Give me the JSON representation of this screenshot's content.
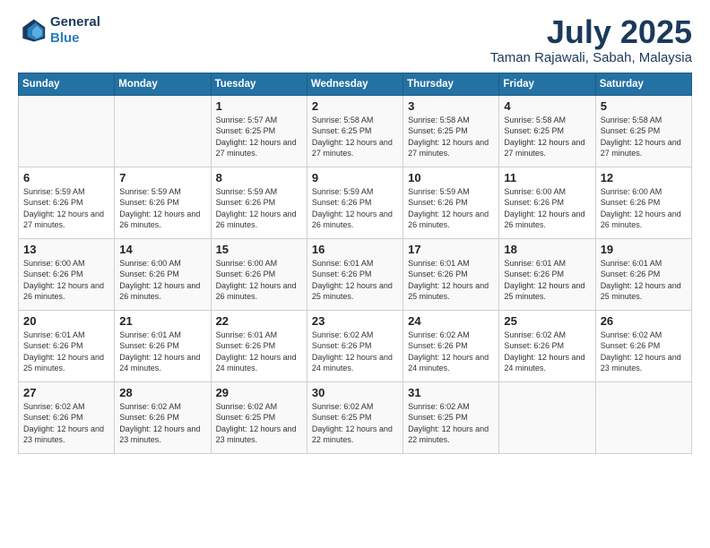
{
  "logo": {
    "line1": "General",
    "line2": "Blue"
  },
  "title": "July 2025",
  "subtitle": "Taman Rajawali, Sabah, Malaysia",
  "days_of_week": [
    "Sunday",
    "Monday",
    "Tuesday",
    "Wednesday",
    "Thursday",
    "Friday",
    "Saturday"
  ],
  "weeks": [
    [
      {
        "day": "",
        "info": ""
      },
      {
        "day": "",
        "info": ""
      },
      {
        "day": "1",
        "info": "Sunrise: 5:57 AM\nSunset: 6:25 PM\nDaylight: 12 hours and 27 minutes."
      },
      {
        "day": "2",
        "info": "Sunrise: 5:58 AM\nSunset: 6:25 PM\nDaylight: 12 hours and 27 minutes."
      },
      {
        "day": "3",
        "info": "Sunrise: 5:58 AM\nSunset: 6:25 PM\nDaylight: 12 hours and 27 minutes."
      },
      {
        "day": "4",
        "info": "Sunrise: 5:58 AM\nSunset: 6:25 PM\nDaylight: 12 hours and 27 minutes."
      },
      {
        "day": "5",
        "info": "Sunrise: 5:58 AM\nSunset: 6:25 PM\nDaylight: 12 hours and 27 minutes."
      }
    ],
    [
      {
        "day": "6",
        "info": "Sunrise: 5:59 AM\nSunset: 6:26 PM\nDaylight: 12 hours and 27 minutes."
      },
      {
        "day": "7",
        "info": "Sunrise: 5:59 AM\nSunset: 6:26 PM\nDaylight: 12 hours and 26 minutes."
      },
      {
        "day": "8",
        "info": "Sunrise: 5:59 AM\nSunset: 6:26 PM\nDaylight: 12 hours and 26 minutes."
      },
      {
        "day": "9",
        "info": "Sunrise: 5:59 AM\nSunset: 6:26 PM\nDaylight: 12 hours and 26 minutes."
      },
      {
        "day": "10",
        "info": "Sunrise: 5:59 AM\nSunset: 6:26 PM\nDaylight: 12 hours and 26 minutes."
      },
      {
        "day": "11",
        "info": "Sunrise: 6:00 AM\nSunset: 6:26 PM\nDaylight: 12 hours and 26 minutes."
      },
      {
        "day": "12",
        "info": "Sunrise: 6:00 AM\nSunset: 6:26 PM\nDaylight: 12 hours and 26 minutes."
      }
    ],
    [
      {
        "day": "13",
        "info": "Sunrise: 6:00 AM\nSunset: 6:26 PM\nDaylight: 12 hours and 26 minutes."
      },
      {
        "day": "14",
        "info": "Sunrise: 6:00 AM\nSunset: 6:26 PM\nDaylight: 12 hours and 26 minutes."
      },
      {
        "day": "15",
        "info": "Sunrise: 6:00 AM\nSunset: 6:26 PM\nDaylight: 12 hours and 26 minutes."
      },
      {
        "day": "16",
        "info": "Sunrise: 6:01 AM\nSunset: 6:26 PM\nDaylight: 12 hours and 25 minutes."
      },
      {
        "day": "17",
        "info": "Sunrise: 6:01 AM\nSunset: 6:26 PM\nDaylight: 12 hours and 25 minutes."
      },
      {
        "day": "18",
        "info": "Sunrise: 6:01 AM\nSunset: 6:26 PM\nDaylight: 12 hours and 25 minutes."
      },
      {
        "day": "19",
        "info": "Sunrise: 6:01 AM\nSunset: 6:26 PM\nDaylight: 12 hours and 25 minutes."
      }
    ],
    [
      {
        "day": "20",
        "info": "Sunrise: 6:01 AM\nSunset: 6:26 PM\nDaylight: 12 hours and 25 minutes."
      },
      {
        "day": "21",
        "info": "Sunrise: 6:01 AM\nSunset: 6:26 PM\nDaylight: 12 hours and 24 minutes."
      },
      {
        "day": "22",
        "info": "Sunrise: 6:01 AM\nSunset: 6:26 PM\nDaylight: 12 hours and 24 minutes."
      },
      {
        "day": "23",
        "info": "Sunrise: 6:02 AM\nSunset: 6:26 PM\nDaylight: 12 hours and 24 minutes."
      },
      {
        "day": "24",
        "info": "Sunrise: 6:02 AM\nSunset: 6:26 PM\nDaylight: 12 hours and 24 minutes."
      },
      {
        "day": "25",
        "info": "Sunrise: 6:02 AM\nSunset: 6:26 PM\nDaylight: 12 hours and 24 minutes."
      },
      {
        "day": "26",
        "info": "Sunrise: 6:02 AM\nSunset: 6:26 PM\nDaylight: 12 hours and 23 minutes."
      }
    ],
    [
      {
        "day": "27",
        "info": "Sunrise: 6:02 AM\nSunset: 6:26 PM\nDaylight: 12 hours and 23 minutes."
      },
      {
        "day": "28",
        "info": "Sunrise: 6:02 AM\nSunset: 6:26 PM\nDaylight: 12 hours and 23 minutes."
      },
      {
        "day": "29",
        "info": "Sunrise: 6:02 AM\nSunset: 6:25 PM\nDaylight: 12 hours and 23 minutes."
      },
      {
        "day": "30",
        "info": "Sunrise: 6:02 AM\nSunset: 6:25 PM\nDaylight: 12 hours and 22 minutes."
      },
      {
        "day": "31",
        "info": "Sunrise: 6:02 AM\nSunset: 6:25 PM\nDaylight: 12 hours and 22 minutes."
      },
      {
        "day": "",
        "info": ""
      },
      {
        "day": "",
        "info": ""
      }
    ]
  ]
}
